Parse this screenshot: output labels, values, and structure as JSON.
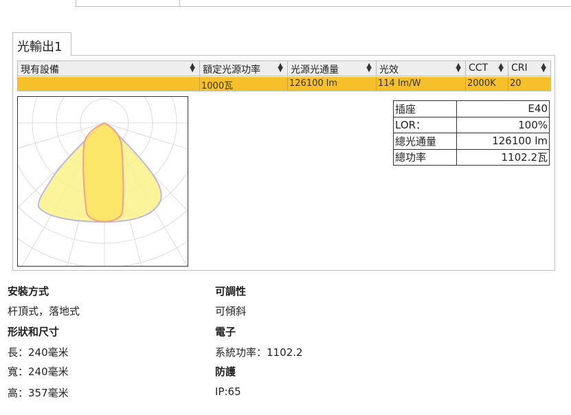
{
  "tab": {
    "label": "光輸出1"
  },
  "grid": {
    "columns": [
      "現有設備",
      "額定光源功率",
      "光源光通量",
      "光效",
      "CCT",
      "CRI"
    ],
    "row": [
      "",
      "1000瓦",
      "126100 lm",
      "114 lm/W",
      "2000K",
      "20"
    ]
  },
  "summary": [
    {
      "key": "插座",
      "value": "E40"
    },
    {
      "key": "LOR：",
      "value": "100%"
    },
    {
      "key": "總光通量",
      "value": "126100 lm"
    },
    {
      "key": "總功率",
      "value": "1102.2瓦"
    }
  ],
  "specs": {
    "install_heading": "安裝方式",
    "install_value": "杆頂式，落地式",
    "shape_heading": "形狀和尺寸",
    "length": "長：240毫米",
    "width": "寬：240毫米",
    "height": "高：357毫米",
    "adjust_heading": "可調性",
    "adjust_value": "可傾斜",
    "electronic_heading": "電子",
    "system_power": "系統功率：1102.2",
    "protection_heading": "防護",
    "protection_value": "IP:65"
  },
  "colors": {
    "selected_row": "#f5c02a",
    "header_bg": "#eeeeee",
    "curve_c0": "#fbf28a",
    "curve_c90": "#fbe25c"
  }
}
